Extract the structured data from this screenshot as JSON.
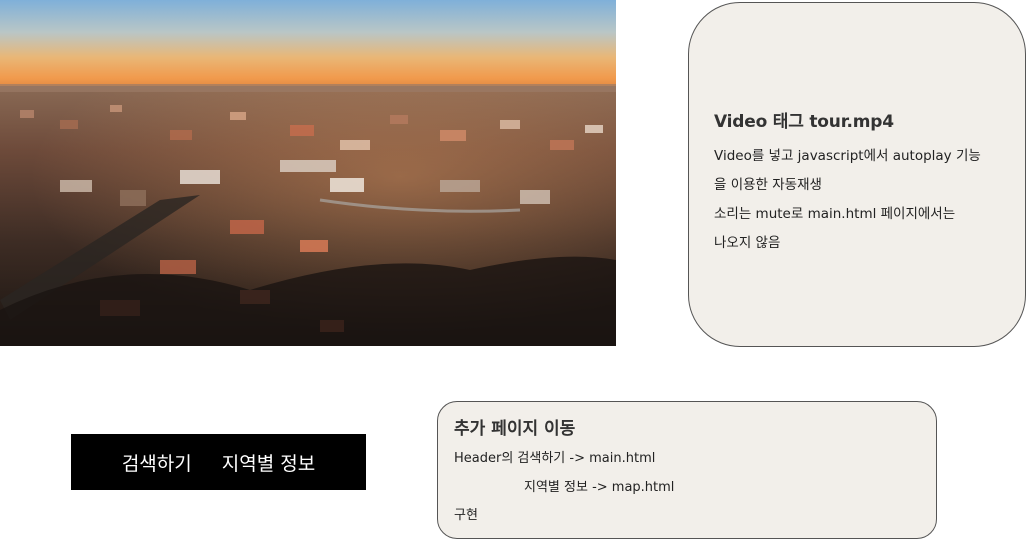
{
  "video": {
    "file": "tour.mp4",
    "scene": "aerial-city-at-sunset"
  },
  "note": {
    "title": "Video 태그 tour.mp4",
    "lines": [
      "Video를 넣고 javascript에서 autoplay 기능",
      "을 이용한 자동재생",
      "소리는 mute로 main.html 페이지에서는",
      "나오지 않음"
    ]
  },
  "nav": {
    "items": [
      "검색하기",
      "지역별 정보"
    ]
  },
  "move": {
    "title": "추가 페이지 이동",
    "lines": [
      "Header의 검색하기 -> main.html",
      "지역별 정보 -> map.html",
      "구현"
    ]
  },
  "colors": {
    "card_bg": "#f2efea",
    "nav_bg": "#000000",
    "nav_text": "#ffffff"
  }
}
